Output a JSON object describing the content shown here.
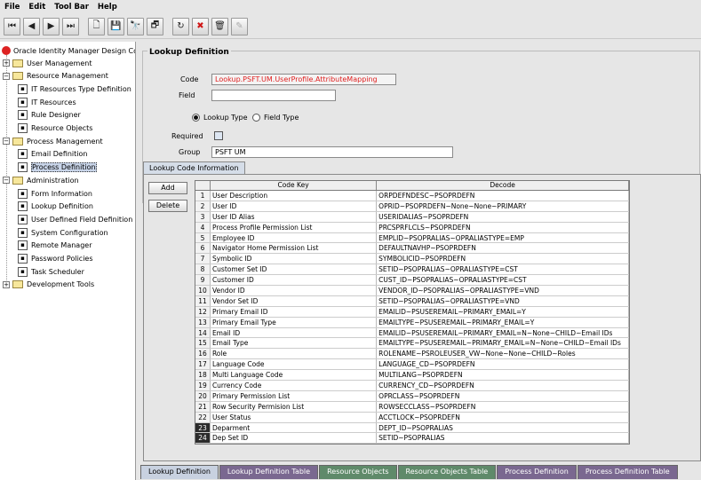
{
  "menu": [
    "File",
    "Edit",
    "Tool Bar",
    "Help"
  ],
  "toolbar": {
    "buttons": [
      {
        "icon": "first-record-icon",
        "glyph": "⏮"
      },
      {
        "icon": "previous-record-icon",
        "glyph": "◀"
      },
      {
        "icon": "next-record-icon",
        "glyph": "▶"
      },
      {
        "icon": "last-record-icon",
        "glyph": "⏭"
      },
      {
        "icon": "new-icon",
        "glyph": "🗋"
      },
      {
        "icon": "save-icon",
        "glyph": "💾"
      },
      {
        "icon": "find-icon",
        "glyph": "🔭"
      },
      {
        "icon": "query-icon",
        "glyph": "🗗"
      },
      {
        "icon": "refresh-icon",
        "glyph": "↻"
      },
      {
        "icon": "cancel-icon",
        "glyph": "✖"
      },
      {
        "icon": "delete-icon",
        "glyph": "🗑"
      },
      {
        "icon": "notes-icon",
        "glyph": "✎"
      }
    ]
  },
  "tree": {
    "root": "Oracle Identity Manager Design Console",
    "nodes": [
      {
        "label": "User Management",
        "type": "folder",
        "level": 0
      },
      {
        "label": "Resource Management",
        "type": "folder",
        "level": 0
      },
      {
        "label": "IT Resources Type Definition",
        "type": "item",
        "level": 1
      },
      {
        "label": "IT Resources",
        "type": "item",
        "level": 1
      },
      {
        "label": "Rule Designer",
        "type": "item",
        "level": 1
      },
      {
        "label": "Resource Objects",
        "type": "item",
        "level": 1
      },
      {
        "label": "Process Management",
        "type": "folder",
        "level": 0
      },
      {
        "label": "Email Definition",
        "type": "item",
        "level": 1
      },
      {
        "label": "Process Definition",
        "type": "item",
        "level": 1,
        "selected": true
      },
      {
        "label": "Administration",
        "type": "folder",
        "level": 0
      },
      {
        "label": "Form Information",
        "type": "item",
        "level": 1
      },
      {
        "label": "Lookup Definition",
        "type": "item",
        "level": 1
      },
      {
        "label": "User Defined Field Definition",
        "type": "item",
        "level": 1
      },
      {
        "label": "System Configuration",
        "type": "item",
        "level": 1
      },
      {
        "label": "Remote Manager",
        "type": "item",
        "level": 1
      },
      {
        "label": "Password Policies",
        "type": "item",
        "level": 1
      },
      {
        "label": "Task Scheduler",
        "type": "item",
        "level": 1
      },
      {
        "label": "Development Tools",
        "type": "folder",
        "level": 0
      }
    ]
  },
  "form": {
    "title": "Lookup Definition",
    "code_label": "Code",
    "code_value": "Lookup.PSFT.UM.UserProfile.AttributeMapping",
    "field_label": "Field",
    "field_value": "",
    "radio_lookup": "Lookup Type",
    "radio_field": "Field Type",
    "required_label": "Required",
    "group_label": "Group",
    "group_value": "PSFT UM"
  },
  "section_tab": "Lookup Code Information",
  "buttons": {
    "add": "Add",
    "delete": "Delete"
  },
  "grid": {
    "headers": [
      "Code Key",
      "Decode"
    ],
    "rows": [
      [
        "User Description",
        "ORPDEFNDESC~PSOPRDEFN"
      ],
      [
        "User ID",
        "OPRID~PSOPRDEFN~None~None~PRIMARY"
      ],
      [
        "User ID Alias",
        "USERIDALIAS~PSOPRDEFN"
      ],
      [
        "Process Profile Permission List",
        "PRCSPRFLCLS~PSOPRDEFN"
      ],
      [
        "Employee ID",
        "EMPLID~PSOPRALIAS~OPRALIASTYPE=EMP"
      ],
      [
        "Navigator Home Permission List",
        "DEFAULTNAVHP~PSOPRDEFN"
      ],
      [
        "Symbolic ID",
        "SYMBOLICID~PSOPRDEFN"
      ],
      [
        "Customer Set ID",
        "SETID~PSOPRALIAS~OPRALIASTYPE=CST"
      ],
      [
        "Customer ID",
        "CUST_ID~PSOPRALIAS~OPRALIASTYPE=CST"
      ],
      [
        "Vendor ID",
        "VENDOR_ID~PSOPRALIAS~OPRALIASTYPE=VND"
      ],
      [
        "Vendor Set ID",
        "SETID~PSOPRALIAS~OPRALIASTYPE=VND"
      ],
      [
        "Primary Email ID",
        "EMAILID~PSUSEREMAIL~PRIMARY_EMAIL=Y"
      ],
      [
        "Primary Email Type",
        "EMAILTYPE~PSUSEREMAIL~PRIMARY_EMAIL=Y"
      ],
      [
        "Email ID",
        "EMAILID~PSUSEREMAIL~PRIMARY_EMAIL=N~None~CHILD~Email IDs"
      ],
      [
        "Email Type",
        "EMAILTYPE~PSUSEREMAIL~PRIMARY_EMAIL=N~None~CHILD~Email IDs"
      ],
      [
        "Role",
        "ROLENAME~PSROLEUSER_VW~None~None~CHILD~Roles"
      ],
      [
        "Language Code",
        "LANGUAGE_CD~PSOPRDEFN"
      ],
      [
        "Multi Language Code",
        "MULTILANG~PSOPRDEFN"
      ],
      [
        "Currency Code",
        "CURRENCY_CD~PSOPRDEFN"
      ],
      [
        "Primary Permission List",
        "OPRCLASS~PSOPRDEFN"
      ],
      [
        "Row Security Permision List",
        "ROWSECCLASS~PSOPRDEFN"
      ],
      [
        "User Status",
        "ACCTLOCK~PSOPRDEFN"
      ],
      [
        "Deparment",
        "DEPT_ID~PSOPRALIAS"
      ],
      [
        "Dep Set ID",
        "SETID~PSOPRALIAS"
      ]
    ]
  },
  "bottom_tabs": [
    {
      "label": "Lookup Definition",
      "color": "#c8d1e0",
      "fg": "#000"
    },
    {
      "label": "Lookup Definition Table",
      "color": "#7a6890",
      "fg": "#fff"
    },
    {
      "label": "Resource Objects",
      "color": "#5f8a6a",
      "fg": "#fff"
    },
    {
      "label": "Resource Objects Table",
      "color": "#5f8a6a",
      "fg": "#fff"
    },
    {
      "label": "Process Definition",
      "color": "#7a6890",
      "fg": "#fff"
    },
    {
      "label": "Process Definition Table",
      "color": "#7a6890",
      "fg": "#fff"
    }
  ]
}
